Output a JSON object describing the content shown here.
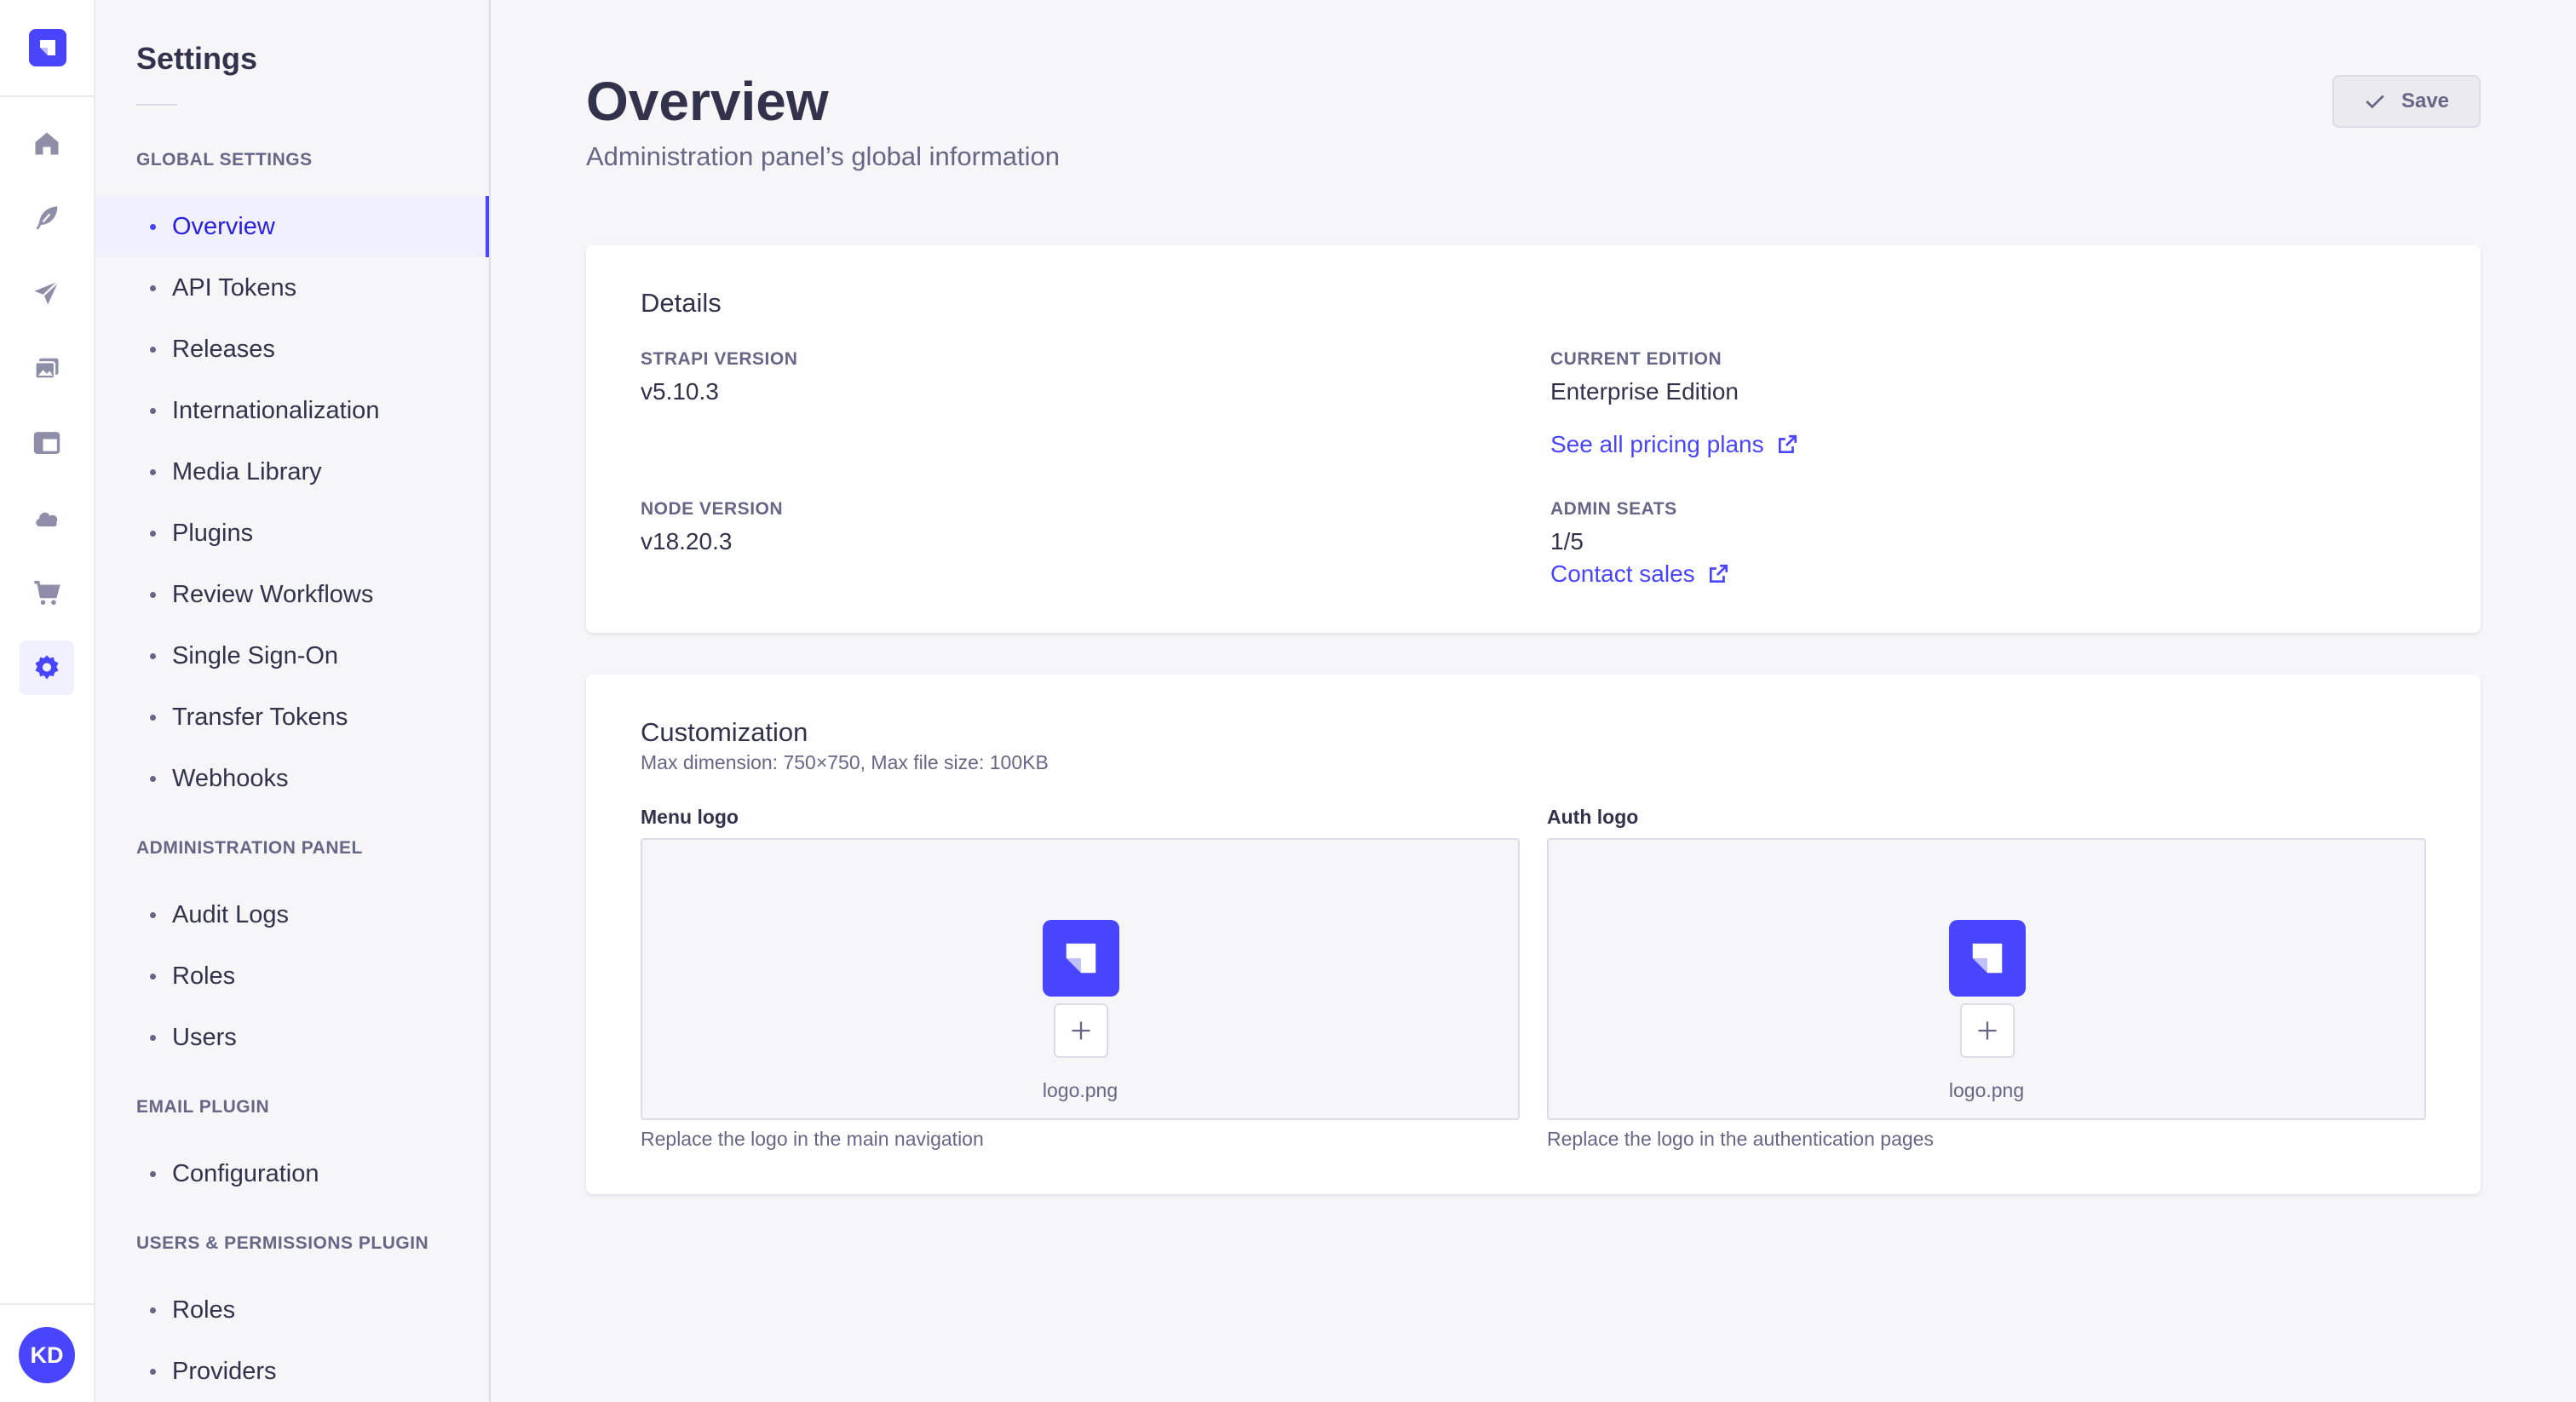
{
  "app": {
    "colors": {
      "primary": "#4945ff",
      "active_bg": "#f0f0ff",
      "text": "#32324d",
      "muted": "#666687"
    }
  },
  "rail": {
    "logo_icon": "strapi-logo-icon",
    "items": [
      {
        "name": "home-icon",
        "active": false
      },
      {
        "name": "content-manager-icon",
        "active": false
      },
      {
        "name": "releases-icon",
        "active": false
      },
      {
        "name": "media-library-icon",
        "active": false
      },
      {
        "name": "content-type-builder-icon",
        "active": false
      },
      {
        "name": "cloud-icon",
        "active": false
      },
      {
        "name": "marketplace-icon",
        "active": false
      },
      {
        "name": "settings-icon",
        "active": true
      }
    ],
    "user_initials": "KD"
  },
  "subnav": {
    "title": "Settings",
    "sections": [
      {
        "label": "Global Settings",
        "items": [
          "Overview",
          "API Tokens",
          "Releases",
          "Internationalization",
          "Media Library",
          "Plugins",
          "Review Workflows",
          "Single Sign-On",
          "Transfer Tokens",
          "Webhooks"
        ]
      },
      {
        "label": "Administration Panel",
        "items": [
          "Audit Logs",
          "Roles",
          "Users"
        ]
      },
      {
        "label": "Email Plugin",
        "items": [
          "Configuration"
        ]
      },
      {
        "label": "Users & Permissions Plugin",
        "items": [
          "Roles",
          "Providers"
        ]
      }
    ],
    "active_item": "Overview"
  },
  "header": {
    "title": "Overview",
    "subtitle": "Administration panel’s global information",
    "save_label": "Save"
  },
  "details": {
    "heading": "Details",
    "strapi_version_label": "Strapi Version",
    "strapi_version": "v5.10.3",
    "current_edition_label": "Current Edition",
    "current_edition": "Enterprise Edition",
    "pricing_link": "See all pricing plans",
    "node_version_label": "Node Version",
    "node_version": "v18.20.3",
    "admin_seats_label": "Admin Seats",
    "admin_seats": "1/5",
    "contact_link": "Contact sales"
  },
  "customization": {
    "heading": "Customization",
    "subtitle": "Max dimension: 750×750, Max file size: 100KB",
    "menu_logo": {
      "label": "Menu logo",
      "file": "logo.png",
      "hint": "Replace the logo in the main navigation"
    },
    "auth_logo": {
      "label": "Auth logo",
      "file": "logo.png",
      "hint": "Replace the logo in the authentication pages"
    }
  }
}
